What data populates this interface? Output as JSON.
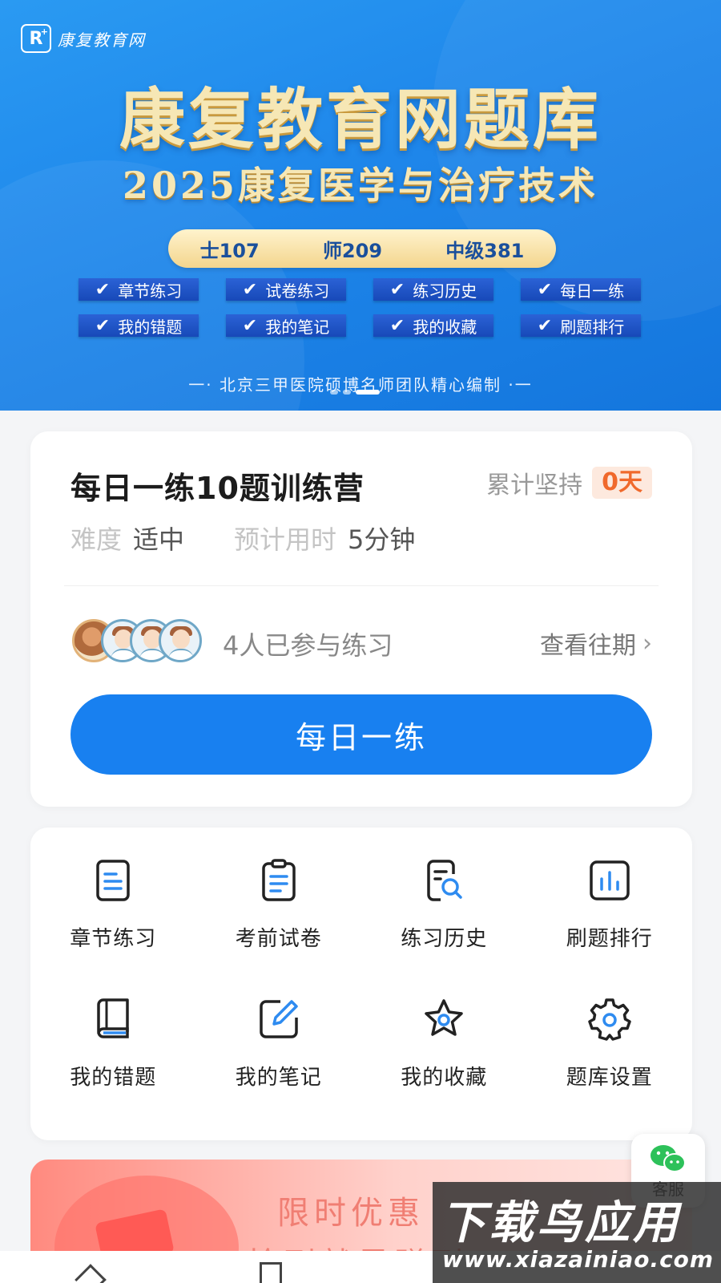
{
  "banner": {
    "logo_mark": "R",
    "logo_text": "康复教育网",
    "title": "康复教育网题库",
    "subtitle": "2025康复医学与治疗技术",
    "levels": [
      "士107",
      "师209",
      "中级381"
    ],
    "features": [
      "章节练习",
      "试卷练习",
      "练习历史",
      "每日一练",
      "我的错题",
      "我的笔记",
      "我的收藏",
      "刷题排行"
    ],
    "slogan": "一· 北京三甲医院硕博名师团队精心编制 ·一",
    "colors": {
      "background": "#1e86ea",
      "title_gold": "#f6e7b5",
      "level_pill": "#f3d58d",
      "feature_bg": "#1749b8"
    }
  },
  "daily": {
    "title": "每日一练10题训练营",
    "streak_label": "累计坚持",
    "streak_value": "0天",
    "difficulty_label": "难度",
    "difficulty_value": "适中",
    "time_label": "预计用时",
    "time_value": "5分钟",
    "participants": "4人已参与练习",
    "history_link": "查看往期",
    "button": "每日一练",
    "colors": {
      "button": "#1880f0",
      "streak_badge_text": "#f0692c",
      "streak_badge_bg": "#fde9de"
    }
  },
  "grid": {
    "items": [
      {
        "label": "章节练习",
        "icon": "document-list-icon"
      },
      {
        "label": "考前试卷",
        "icon": "clipboard-icon"
      },
      {
        "label": "练习历史",
        "icon": "search-document-icon"
      },
      {
        "label": "刷题排行",
        "icon": "bar-chart-icon"
      },
      {
        "label": "我的错题",
        "icon": "book-icon"
      },
      {
        "label": "我的笔记",
        "icon": "edit-note-icon"
      },
      {
        "label": "我的收藏",
        "icon": "star-icon"
      },
      {
        "label": "题库设置",
        "icon": "gear-icon"
      }
    ]
  },
  "promo": {
    "line1": "限时优惠",
    "line2": "抢到就是赚到"
  },
  "service": {
    "label": "客服",
    "icon": "wechat-icon"
  },
  "watermark": {
    "big": "下载鸟应用",
    "small": "www.xiazainiao.com"
  }
}
